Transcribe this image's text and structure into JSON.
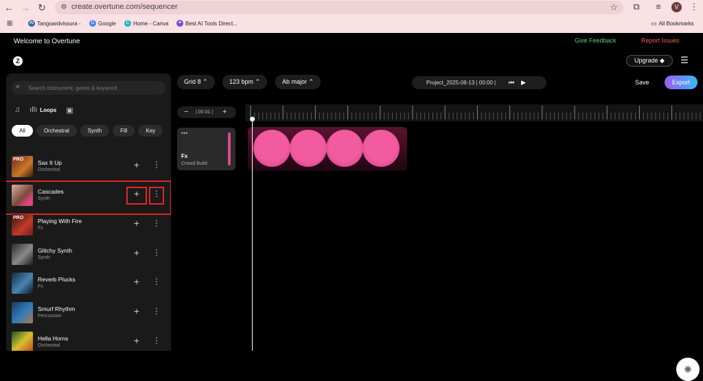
{
  "browser": {
    "url": "create.overtune.com/sequencer",
    "avatar_letter": "V",
    "bookmarks": [
      "Tangoardvissura -",
      "Google",
      "Home - Canva",
      "Best AI Tools Direct..."
    ],
    "all_bookmarks": "All Bookmarks"
  },
  "header": {
    "welcome": "Welcome to Overtune",
    "give_feedback": "Give Feedback",
    "report_issues": "Report Issues",
    "upgrade": "Upgrade ◆"
  },
  "toolbar": {
    "grid": "Grid 8 ⌃",
    "bpm": "123 bpm ⌃",
    "key": "Ab major ⌃",
    "project": "Project_2025-06-13 | 00:00 |",
    "save": "Save",
    "export": "Export"
  },
  "sidebar": {
    "search_placeholder": "Search instrument, genre & keyword",
    "tab_loops": "Loops",
    "filters": [
      "All",
      "Orchestral",
      "Synth",
      "Fill",
      "Key"
    ],
    "items": [
      {
        "name": "Sax It Up",
        "genre": "Orchestral"
      },
      {
        "name": "Cascades",
        "genre": "Synth"
      },
      {
        "name": "Playing With Fire",
        "genre": "Fx"
      },
      {
        "name": "Glitchy Synth",
        "genre": "Synth"
      },
      {
        "name": "Reverb Plucks",
        "genre": "Fx"
      },
      {
        "name": "Smurf Rhythm",
        "genre": "Percussion"
      },
      {
        "name": "Hella Horns",
        "genre": "Orchestral"
      }
    ],
    "pro_label": "PRO"
  },
  "timeline": {
    "zoom_time": "| 00:31 |",
    "track": {
      "name": "Fx",
      "subtitle": "Crowd Build"
    }
  },
  "colors": {
    "accent_pink": "#f25ba0",
    "feedback_green": "#5ad17a",
    "report_red": "#ff5a4e",
    "highlight_red": "#e32626"
  }
}
